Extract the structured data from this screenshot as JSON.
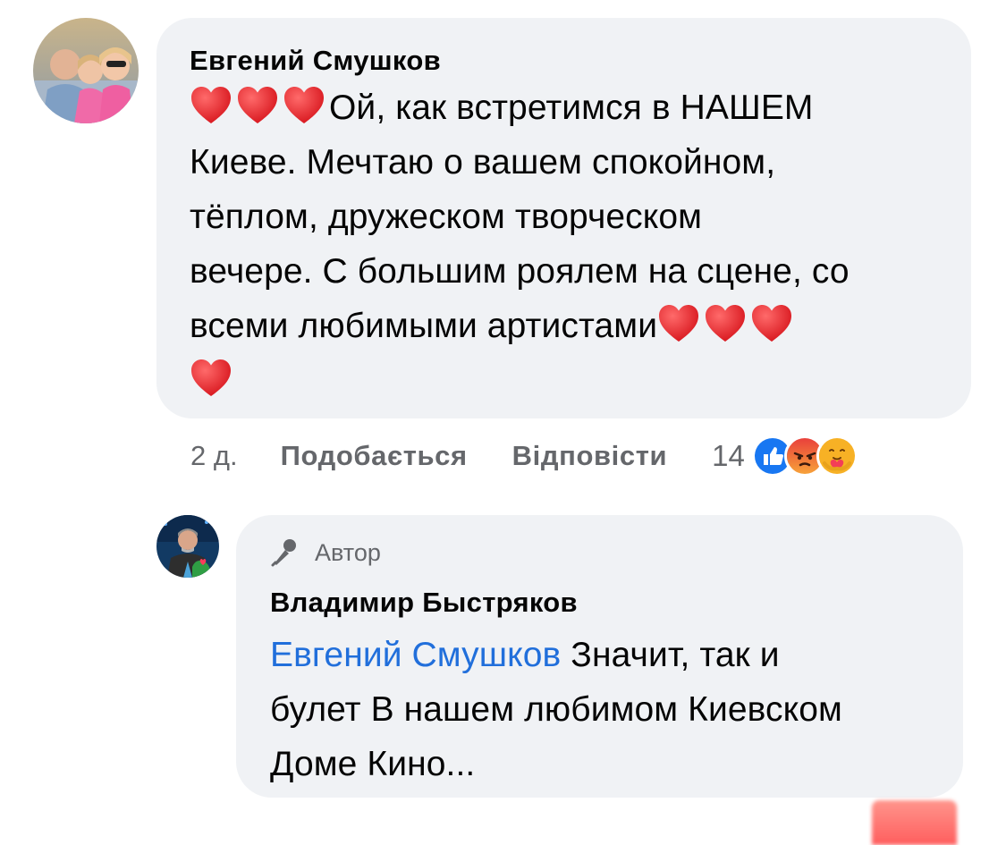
{
  "comment": {
    "author": "Евгений Смушков",
    "lines": [
      "Ой, как встретимся в НАШЕМ",
      "Киеве. Мечтаю о вашем спокойном,",
      "тёплом, дружеском творческом",
      "вечере. С большим роялем на сцене, со",
      "всеми любимыми артистами"
    ],
    "time": "2 д.",
    "like_label": "Подобається",
    "reply_label": "Відповісти",
    "reaction_count": "14",
    "reactions": [
      "like-icon",
      "angry-icon",
      "care-icon"
    ],
    "emoji": "heart-emoji",
    "colors": {
      "heart": "#e8121b",
      "like": "#1877f2",
      "angry": "#f7553a",
      "care": "#f7b125"
    }
  },
  "reply": {
    "badge_label": "Автор",
    "badge_icon": "microphone-icon",
    "author": "Владимир Быстряков",
    "mention": "Евгений Смушков",
    "lines": [
      "Значит, так и",
      "булет В нашем любимом Киевском",
      "Доме Кино..."
    ],
    "mention_color": "#216fdb"
  }
}
